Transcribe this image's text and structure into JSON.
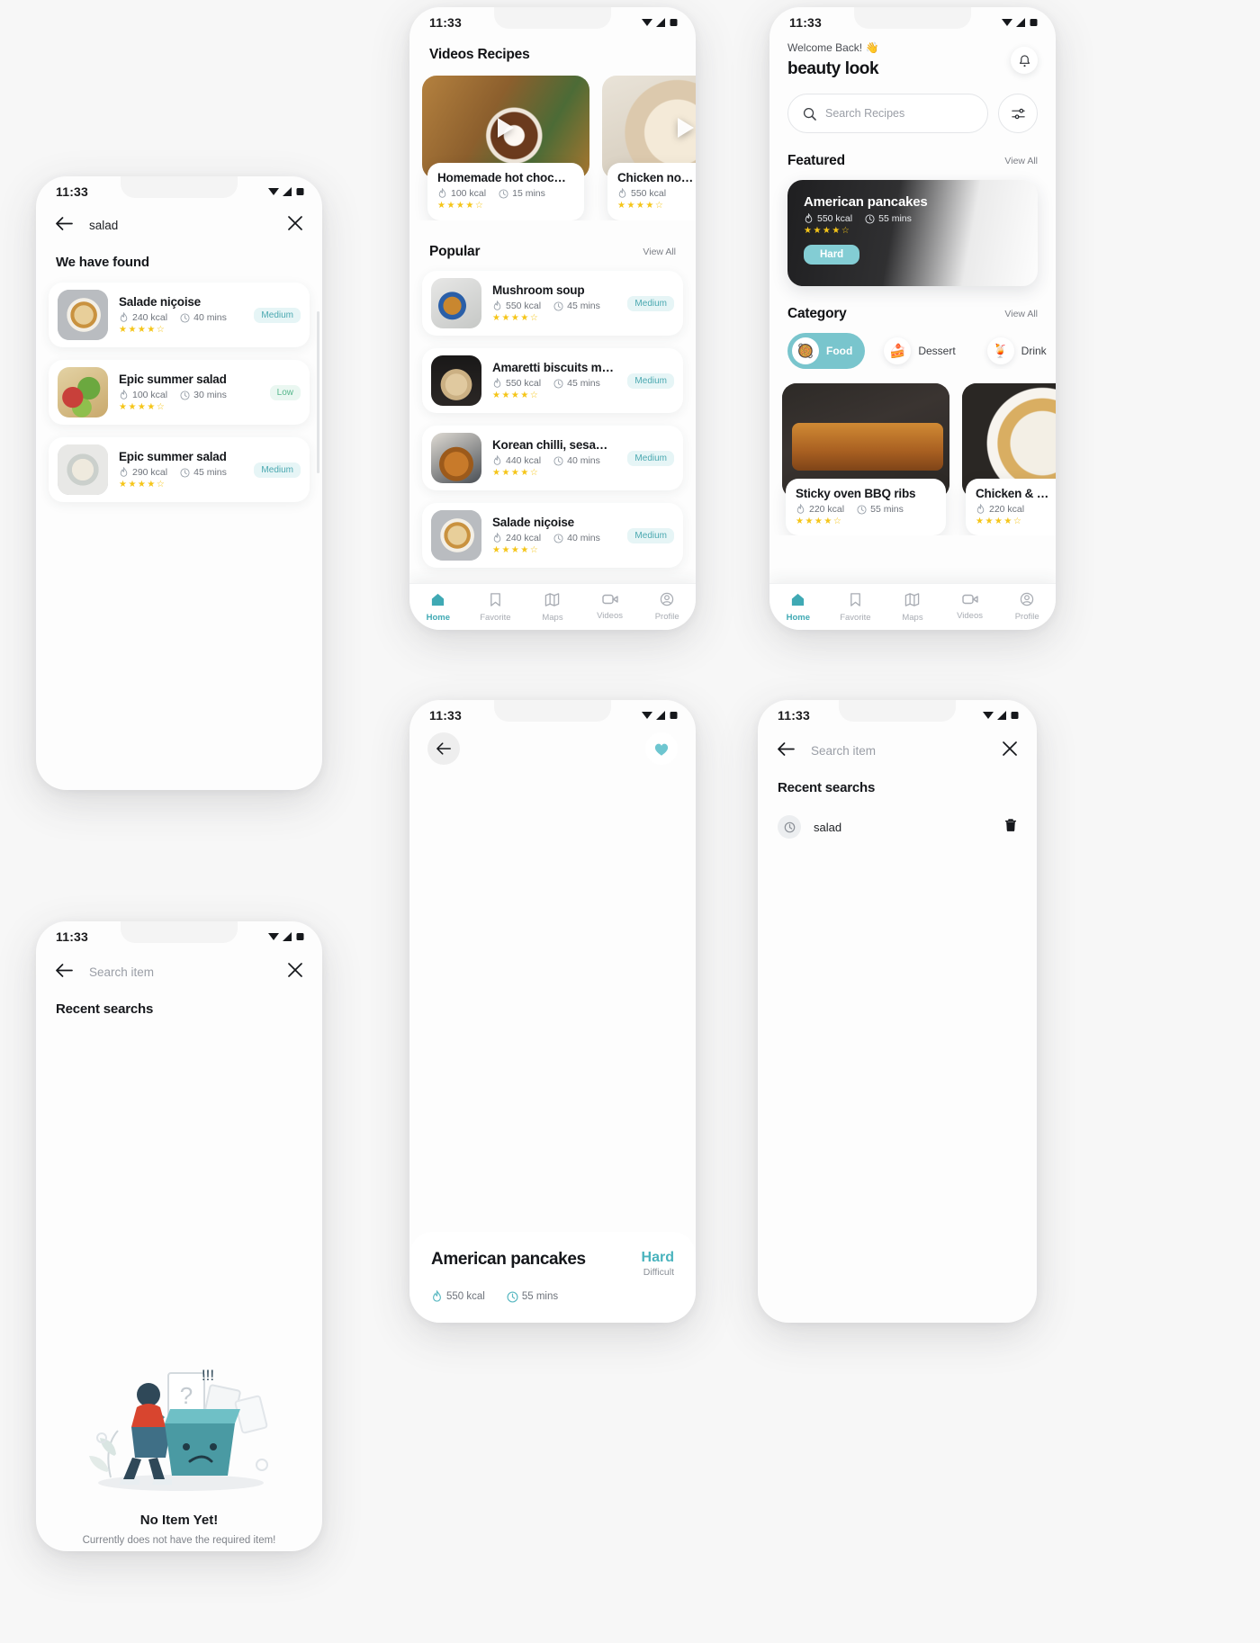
{
  "meta": {
    "status_time": "11:33"
  },
  "screens": {
    "search_results": {
      "query_value": "salad",
      "heading": "We have found",
      "back_icon": "arrow-left-icon",
      "close_icon": "close-icon",
      "results": [
        {
          "title": "Salade niçoise",
          "kcal": "240 kcal",
          "time": "40 mins",
          "rating": "★★★★☆",
          "difficulty": "Medium",
          "level": "medium",
          "photo": "ph-nicoise"
        },
        {
          "title": "Epic summer salad",
          "kcal": "100 kcal",
          "time": "30 mins",
          "rating": "★★★★☆",
          "difficulty": "Low",
          "level": "low",
          "photo": "ph-summer"
        },
        {
          "title": "Epic summer salad",
          "kcal": "290 kcal",
          "time": "45 mins",
          "rating": "★★★★☆",
          "difficulty": "Medium",
          "level": "medium",
          "photo": "ph-summer2"
        }
      ]
    },
    "videos": {
      "title": "Videos Recipes",
      "video_cards": [
        {
          "title": "Homemade hot choc…",
          "kcal": "100 kcal",
          "time": "15 mins",
          "rating": "★★★★☆",
          "photo": "ph-choc"
        },
        {
          "title": "Chicken no…",
          "kcal": "550 kcal",
          "time": "",
          "rating": "★★★★☆",
          "photo": "ph-chicken"
        }
      ],
      "popular_label": "Popular",
      "view_all": "View All",
      "popular": [
        {
          "title": "Mushroom soup",
          "kcal": "550 kcal",
          "time": "45 mins",
          "rating": "★★★★☆",
          "difficulty": "Medium",
          "photo": "ph-mushroom"
        },
        {
          "title": "Amaretti biscuits ma…",
          "kcal": "550 kcal",
          "time": "45 mins",
          "rating": "★★★★☆",
          "difficulty": "Medium",
          "photo": "ph-amaretti"
        },
        {
          "title": "Korean chilli, sesame…",
          "kcal": "440 kcal",
          "time": "40 mins",
          "rating": "★★★★☆",
          "difficulty": "Medium",
          "photo": "ph-korean"
        },
        {
          "title": "Salade niçoise",
          "kcal": "240 kcal",
          "time": "40 mins",
          "rating": "★★★★☆",
          "difficulty": "Medium",
          "photo": "ph-nicoise"
        }
      ],
      "nav": [
        {
          "label": "Home",
          "icon": "home-icon",
          "active": true
        },
        {
          "label": "Favorite",
          "icon": "bookmark-icon",
          "active": false
        },
        {
          "label": "Maps",
          "icon": "map-icon",
          "active": false
        },
        {
          "label": "Videos",
          "icon": "video-icon",
          "active": false
        },
        {
          "label": "Profile",
          "icon": "person-icon",
          "active": false
        }
      ]
    },
    "home": {
      "welcome": "Welcome Back!  👋",
      "app_title": "beauty look",
      "bell_icon": "notification-bell-icon",
      "search_placeholder": "Search Recipes",
      "search_icon": "search-icon",
      "filter_icon": "filter-icon",
      "featured_label": "Featured",
      "featured_view_all": "View All",
      "featured": {
        "title": "American pancakes",
        "kcal": "550 kcal",
        "time": "55 mins",
        "rating": "★★★★☆",
        "difficulty": "Hard",
        "photo": "ph-pancake"
      },
      "category_label": "Category",
      "category_view_all": "View All",
      "categories": [
        {
          "label": "Food",
          "emoji": "🥘",
          "active": true
        },
        {
          "label": "Dessert",
          "emoji": "🍰",
          "active": false
        },
        {
          "label": "Drink",
          "emoji": "🍹",
          "active": false
        }
      ],
      "grid": [
        {
          "title": "Sticky oven BBQ ribs",
          "kcal": "220 kcal",
          "time": "55 mins",
          "rating": "★★★★☆",
          "photo": "ph-ribs"
        },
        {
          "title": "Chicken & …",
          "kcal": "220 kcal",
          "time": "",
          "rating": "★★★★☆",
          "photo": "ph-chickennoodle"
        }
      ],
      "nav": [
        {
          "label": "Home",
          "icon": "home-icon",
          "active": true
        },
        {
          "label": "Favorite",
          "icon": "bookmark-icon",
          "active": false
        },
        {
          "label": "Maps",
          "icon": "map-icon",
          "active": false
        },
        {
          "label": "Videos",
          "icon": "video-icon",
          "active": false
        },
        {
          "label": "Profile",
          "icon": "person-icon",
          "active": false
        }
      ]
    },
    "empty_search": {
      "back_icon": "arrow-left-icon",
      "placeholder": "Search item",
      "close_icon": "close-icon",
      "recent_label": "Recent searchs",
      "empty_title": "No Item Yet!",
      "empty_subtitle": "Currently does not have the required item!"
    },
    "recent_search": {
      "back_icon": "arrow-left-icon",
      "placeholder": "Search item",
      "close_icon": "close-icon",
      "recent_label": "Recent searchs",
      "items": [
        {
          "text": "salad",
          "clock_icon": "history-clock-icon",
          "delete_icon": "trash-icon"
        }
      ]
    },
    "detail": {
      "back_icon": "arrow-left-icon",
      "favorite_icon": "heart-icon",
      "title": "American pancakes",
      "difficulty": "Hard",
      "difficulty_label": "Difficult",
      "kcal": "550 kcal",
      "time": "55 mins",
      "photo": "ph-pancake"
    }
  },
  "colors": {
    "accent": "#79c5cd",
    "star": "#f5c518",
    "badge_text": "#4aa8b0",
    "badge_bg": "#e6f5f6",
    "low_text": "#57b78c"
  }
}
